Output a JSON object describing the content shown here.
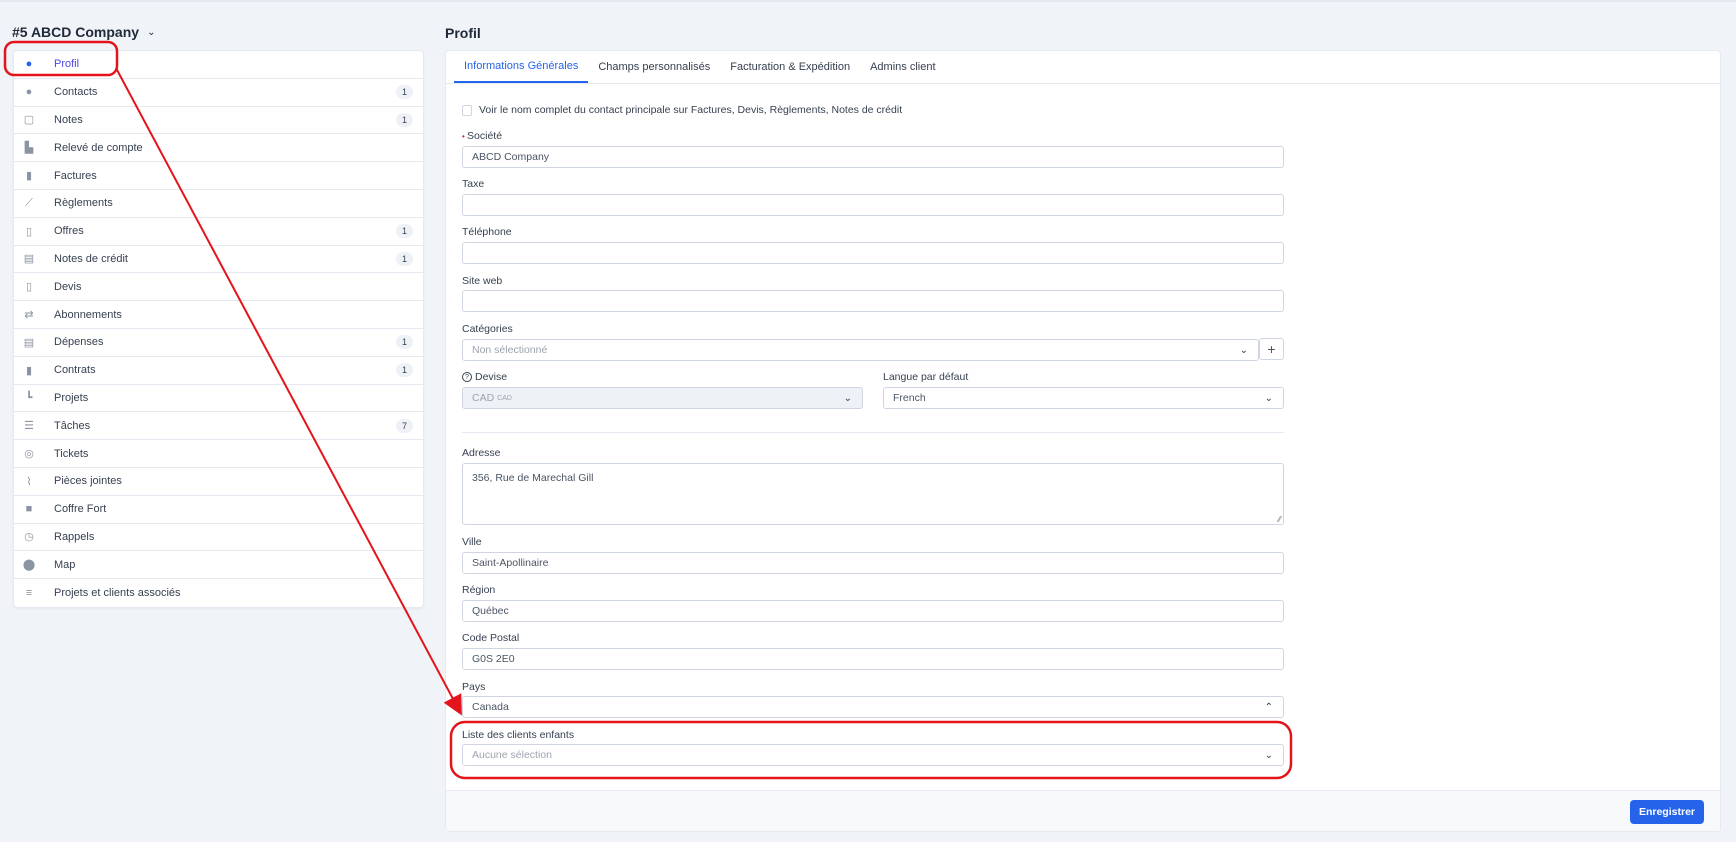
{
  "company": {
    "title": "#5 ABCD Company"
  },
  "sidebar": {
    "items": [
      {
        "label": "Profil",
        "icon": "user-circle-icon",
        "badge": null
      },
      {
        "label": "Contacts",
        "icon": "user-icon",
        "badge": "1"
      },
      {
        "label": "Notes",
        "icon": "sticky-note-icon",
        "badge": "1"
      },
      {
        "label": "Relevé de compte",
        "icon": "area-chart-icon",
        "badge": null
      },
      {
        "label": "Factures",
        "icon": "invoice-file-icon",
        "badge": null
      },
      {
        "label": "Règlements",
        "icon": "line-chart-icon",
        "badge": null
      },
      {
        "label": "Offres",
        "icon": "file-p-icon",
        "badge": "1"
      },
      {
        "label": "Notes de crédit",
        "icon": "file-text-icon",
        "badge": "1"
      },
      {
        "label": "Devis",
        "icon": "file-icon",
        "badge": null
      },
      {
        "label": "Abonnements",
        "icon": "repeat-icon",
        "badge": null
      },
      {
        "label": "Dépenses",
        "icon": "file-text-icon",
        "badge": "1"
      },
      {
        "label": "Contrats",
        "icon": "contract-file-icon",
        "badge": "1"
      },
      {
        "label": "Projets",
        "icon": "chart-steps-icon",
        "badge": null
      },
      {
        "label": "Tâches",
        "icon": "task-list-icon",
        "badge": "7"
      },
      {
        "label": "Tickets",
        "icon": "life-ring-icon",
        "badge": null
      },
      {
        "label": "Pièces jointes",
        "icon": "paperclip-icon",
        "badge": null
      },
      {
        "label": "Coffre Fort",
        "icon": "lock-icon",
        "badge": null
      },
      {
        "label": "Rappels",
        "icon": "clock-icon",
        "badge": null
      },
      {
        "label": "Map",
        "icon": "map-pin-icon",
        "badge": null
      },
      {
        "label": "Projets et clients associés",
        "icon": "menu-lines-icon",
        "badge": null
      }
    ]
  },
  "main": {
    "title": "Profil",
    "tabs": [
      "Informations Générales",
      "Champs personnalisés",
      "Facturation & Expédition",
      "Admins client"
    ],
    "checkbox_label": "Voir le nom complet du contact principale sur Factures, Devis, Règlements, Notes de crédit",
    "fields": {
      "societe": {
        "label": "Société",
        "value": "ABCD Company",
        "required": true
      },
      "taxe": {
        "label": "Taxe",
        "value": ""
      },
      "telephone": {
        "label": "Téléphone",
        "value": ""
      },
      "site_web": {
        "label": "Site web",
        "value": ""
      },
      "categories": {
        "label": "Catégories",
        "placeholder": "Non sélectionné",
        "add": "+"
      },
      "devise": {
        "label": "Devise",
        "value": "CAD",
        "suffix": "CAD"
      },
      "langue": {
        "label": "Langue par défaut",
        "value": "French"
      },
      "adresse": {
        "label": "Adresse",
        "value": "356, Rue de Marechal Gill"
      },
      "ville": {
        "label": "Ville",
        "value": "Saint-Apollinaire"
      },
      "region": {
        "label": "Région",
        "value": "Québec"
      },
      "code_postal": {
        "label": "Code Postal",
        "value": "G0S 2E0"
      },
      "pays": {
        "label": "Pays",
        "value": "Canada"
      },
      "clients_enfants": {
        "label": "Liste des clients enfants",
        "placeholder": "Aucune sélection"
      }
    },
    "save_label": "Enregistrer"
  },
  "colors": {
    "accent": "#2563eb",
    "annotation": "#e3141b"
  }
}
